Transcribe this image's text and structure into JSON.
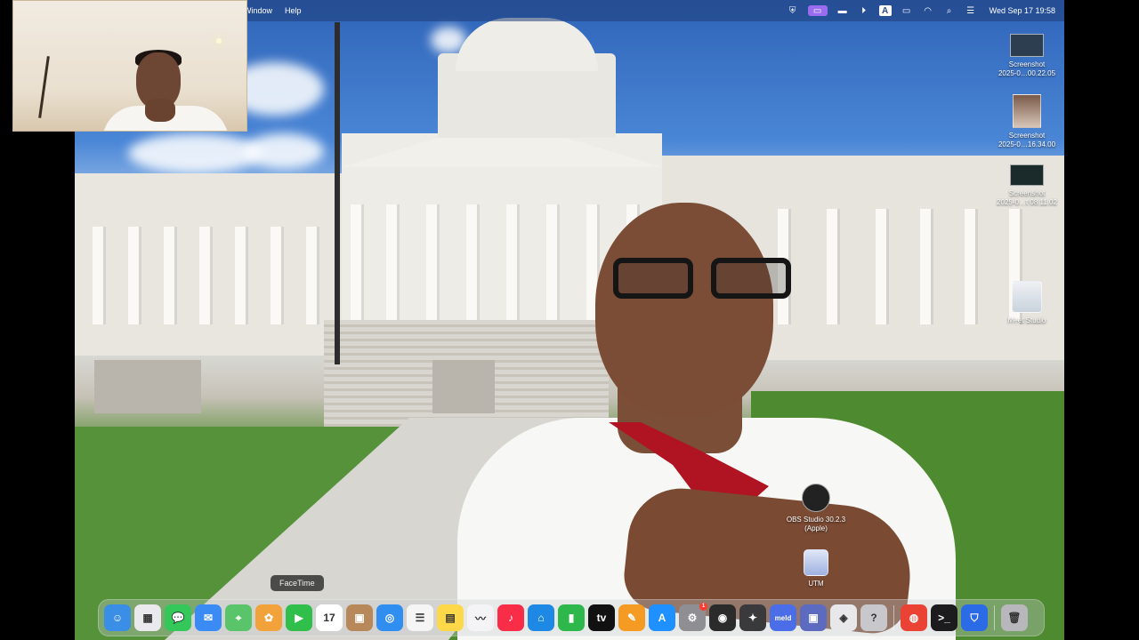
{
  "menubar": {
    "items": [
      "Window",
      "Help"
    ],
    "clock": "Wed Sep 17  19:58",
    "status_icons": [
      "shield-icon",
      "screen-share-icon",
      "display-icon",
      "play-icon",
      "text-input-icon",
      "battery-icon",
      "wifi-icon",
      "search-icon",
      "control-center-icon"
    ]
  },
  "desktop": {
    "icons": [
      {
        "name": "Screenshot",
        "sub": "2025-0…00.22.05"
      },
      {
        "name": "Screenshot",
        "sub": "2025-0…16.34.00"
      },
      {
        "name": "Screenshot",
        "sub": "2025-0…t 08.11.02"
      },
      {
        "name": "Meet Studio",
        "sub": ""
      },
      {
        "name": "OBS Studio 30.2.3",
        "sub": "(Apple)"
      },
      {
        "name": "UTM",
        "sub": ""
      }
    ]
  },
  "dock": {
    "tooltip": "FaceTime",
    "apps": [
      {
        "name": "Finder",
        "icon": "finder-icon",
        "color": "#3a8ee6",
        "glyph": "☺"
      },
      {
        "name": "Launchpad",
        "icon": "launchpad-icon",
        "color": "#e9e9ee",
        "glyph": "▦"
      },
      {
        "name": "Messages",
        "icon": "messages-icon",
        "color": "#34c759",
        "glyph": "💬"
      },
      {
        "name": "Mail",
        "icon": "mail-icon",
        "color": "#3b8bf5",
        "glyph": "✉"
      },
      {
        "name": "Maps",
        "icon": "maps-icon",
        "color": "#5ac46a",
        "glyph": "⌖"
      },
      {
        "name": "Photos",
        "icon": "photos-icon",
        "color": "#f2a23a",
        "glyph": "✿"
      },
      {
        "name": "FaceTime",
        "icon": "facetime-icon",
        "color": "#2fbf4a",
        "glyph": "▶"
      },
      {
        "name": "Calendar",
        "icon": "calendar-icon",
        "color": "#ffffff",
        "glyph": "17"
      },
      {
        "name": "Contacts",
        "icon": "contacts-icon",
        "color": "#b7895a",
        "glyph": "▣"
      },
      {
        "name": "Safari",
        "icon": "safari-icon",
        "color": "#2f8ef0",
        "glyph": "◎"
      },
      {
        "name": "Reminders",
        "icon": "reminders-icon",
        "color": "#f5f5f5",
        "glyph": "☰"
      },
      {
        "name": "Notes",
        "icon": "notes-icon",
        "color": "#ffd84a",
        "glyph": "▤"
      },
      {
        "name": "Freeform",
        "icon": "freeform-icon",
        "color": "#f4f4f6",
        "glyph": "〰"
      },
      {
        "name": "Music",
        "icon": "music-icon",
        "color": "#fa2d48",
        "glyph": "♪"
      },
      {
        "name": "Keynote",
        "icon": "keynote-icon",
        "color": "#1e88e5",
        "glyph": "⌂"
      },
      {
        "name": "Numbers",
        "icon": "numbers-icon",
        "color": "#2eb84b",
        "glyph": "▮"
      },
      {
        "name": "TV",
        "icon": "tv-icon",
        "color": "#111111",
        "glyph": "tv"
      },
      {
        "name": "Pages",
        "icon": "pages-icon",
        "color": "#f59a23",
        "glyph": "✎"
      },
      {
        "name": "App Store",
        "icon": "app-store-icon",
        "color": "#1e90ff",
        "glyph": "A"
      },
      {
        "name": "System Settings",
        "icon": "settings-icon",
        "color": "#8e8e93",
        "glyph": "⚙",
        "badge": "1"
      },
      {
        "name": "OBS Studio",
        "icon": "obs-icon",
        "color": "#2b2b2b",
        "glyph": "◉"
      },
      {
        "name": "DaVinci Resolve",
        "icon": "davinci-icon",
        "color": "#3a3a3c",
        "glyph": "✦"
      },
      {
        "name": "Meld",
        "icon": "meld-icon",
        "color": "#4b6ee8",
        "glyph": "meld"
      },
      {
        "name": "UTM",
        "icon": "utm-icon",
        "color": "#5c6bc0",
        "glyph": "▣"
      },
      {
        "name": "VirtualBuddy",
        "icon": "vm-icon",
        "color": "#e8e8ea",
        "glyph": "◈"
      },
      {
        "name": "Help",
        "icon": "question-icon",
        "color": "#c8c8cc",
        "glyph": "?"
      },
      {
        "name": "Chrome",
        "icon": "chrome-icon",
        "color": "#ea4335",
        "glyph": "◍"
      },
      {
        "name": "Terminal",
        "icon": "terminal-icon",
        "color": "#1c1c1e",
        "glyph": ">_"
      },
      {
        "name": "Brave",
        "icon": "brave-icon",
        "color": "#2b6be6",
        "glyph": "⛉"
      },
      {
        "name": "Trash",
        "icon": "trash-icon",
        "color": "#b8b8bc",
        "glyph": "🗑"
      }
    ]
  }
}
